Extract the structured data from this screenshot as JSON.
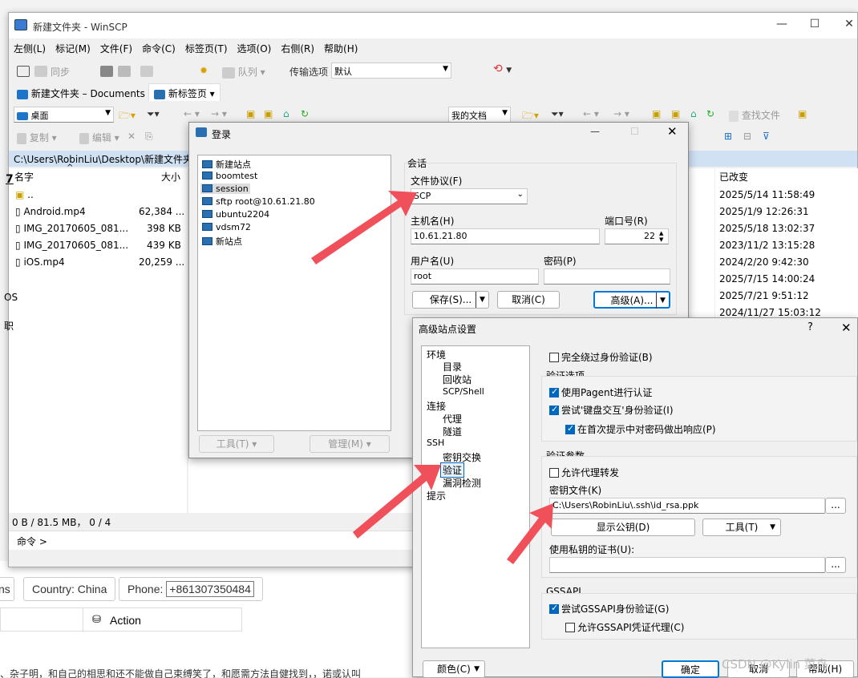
{
  "window": {
    "title": "新建文件夹 - WinSCP"
  },
  "menu": [
    "左侧(L)",
    "标记(M)",
    "文件(F)",
    "命令(C)",
    "标签页(T)",
    "选项(O)",
    "右侧(R)",
    "帮助(H)"
  ],
  "toolbar": {
    "sync": "同步",
    "queue": "队列",
    "transfer_label": "传输选项",
    "transfer_value": "默认"
  },
  "tabs": [
    {
      "label": "新建文件夹 – Documents"
    },
    {
      "label": "新标签页"
    }
  ],
  "left_nav": {
    "drive": "桌面"
  },
  "left_actions": {
    "copy": "复制",
    "edit": "编辑"
  },
  "right_nav": {
    "drive": "我的文档",
    "find": "查找文件"
  },
  "path": "C:\\Users\\RobinLiu\\Desktop\\新建文件夹",
  "columns": {
    "name": "名字",
    "size": "大小",
    "changed": "已改变"
  },
  "files": [
    {
      "name": "..",
      "size": ""
    },
    {
      "name": "Android.mp4",
      "size": "62,384 ..."
    },
    {
      "name": "IMG_20170605_081...",
      "size": "398 KB"
    },
    {
      "name": "IMG_20170605_081...",
      "size": "439 KB"
    },
    {
      "name": "iOS.mp4",
      "size": "20,259 ..."
    }
  ],
  "right_dates": [
    "2025/5/14 11:58:49",
    "2025/1/9 12:26:31",
    "2025/5/18 13:02:37",
    "2023/11/2 13:15:28",
    "2024/2/20 9:42:30",
    "2025/7/15 14:00:24",
    "2025/7/21 9:51:12",
    "2024/11/27 15:03:12"
  ],
  "edge_fragments": {
    "a": "7",
    "b": "OS",
    "c": "职"
  },
  "status": "0 B / 81.5 MB，  0 / 4",
  "command_label": "命令 >",
  "background": {
    "partial": "ns",
    "country": "Country: China",
    "phone_label": "Phone:",
    "phone_value": "+861307350484",
    "action": "Action",
    "bottom_text": "、杂子明，和自己的相思和还不能做自己束缚笑了，和愿需方法自健找到，，诺或认叫"
  },
  "login": {
    "title": "登录",
    "sites": [
      "新建站点",
      "boomtest",
      "session",
      "sftp root@10.61.21.80",
      "ubuntu2204",
      "vdsm72",
      "新站点"
    ],
    "tools": "工具(T)",
    "manage": "管理(M)",
    "session_group": "会话",
    "protocol_label": "文件协议(F)",
    "protocol_value": "SCP",
    "host_label": "主机名(H)",
    "host_value": "10.61.21.80",
    "port_label": "端口号(R)",
    "port_value": "22",
    "user_label": "用户名(U)",
    "user_value": "root",
    "password_label": "密码(P)",
    "password_value": "",
    "save": "保存(S)...",
    "cancel": "取消(C)",
    "advanced": "高级(A)..."
  },
  "advanced": {
    "title": "高级站点设置",
    "help_mark": "?",
    "tree": [
      {
        "label": "环境",
        "level": 0
      },
      {
        "label": "目录",
        "level": 1
      },
      {
        "label": "回收站",
        "level": 1
      },
      {
        "label": "SCP/Shell",
        "level": 1
      },
      {
        "label": "连接",
        "level": 0
      },
      {
        "label": "代理",
        "level": 1
      },
      {
        "label": "隧道",
        "level": 1
      },
      {
        "label": "SSH",
        "level": 0
      },
      {
        "label": "密钥交换",
        "level": 1
      },
      {
        "label": "验证",
        "level": 1
      },
      {
        "label": "漏洞检测",
        "level": 1
      },
      {
        "label": "提示",
        "level": 0
      }
    ],
    "bypass": "完全绕过身份验证(B)",
    "auth_options": "验证选项",
    "pageant": "使用Pagent进行认证",
    "keyboard": "尝试'键盘交互'身份验证(I)",
    "respond": "在首次提示中对密码做出响应(P)",
    "auth_params": "验证参数",
    "agent_fwd": "允许代理转发",
    "keyfile_label": "密钥文件(K)",
    "keyfile_value": "C:\\Users\\RobinLiu\\.ssh\\id_rsa.ppk",
    "browse": "...",
    "show_pubkey": "显示公钥(D)",
    "tools": "工具(T)",
    "cert_label": "使用私钥的证书(U):",
    "cert_value": "",
    "gssapi": "GSSAPI",
    "try_gss": "尝试GSSAPI身份验证(G)",
    "gss_delegate": "允许GSSAPI凭证代理(C)",
    "color": "颜色(C)",
    "ok": "确定",
    "cancel": "取消",
    "help": "帮助(H)"
  },
  "watermark": "CSDN @Kylin 菜鸟"
}
